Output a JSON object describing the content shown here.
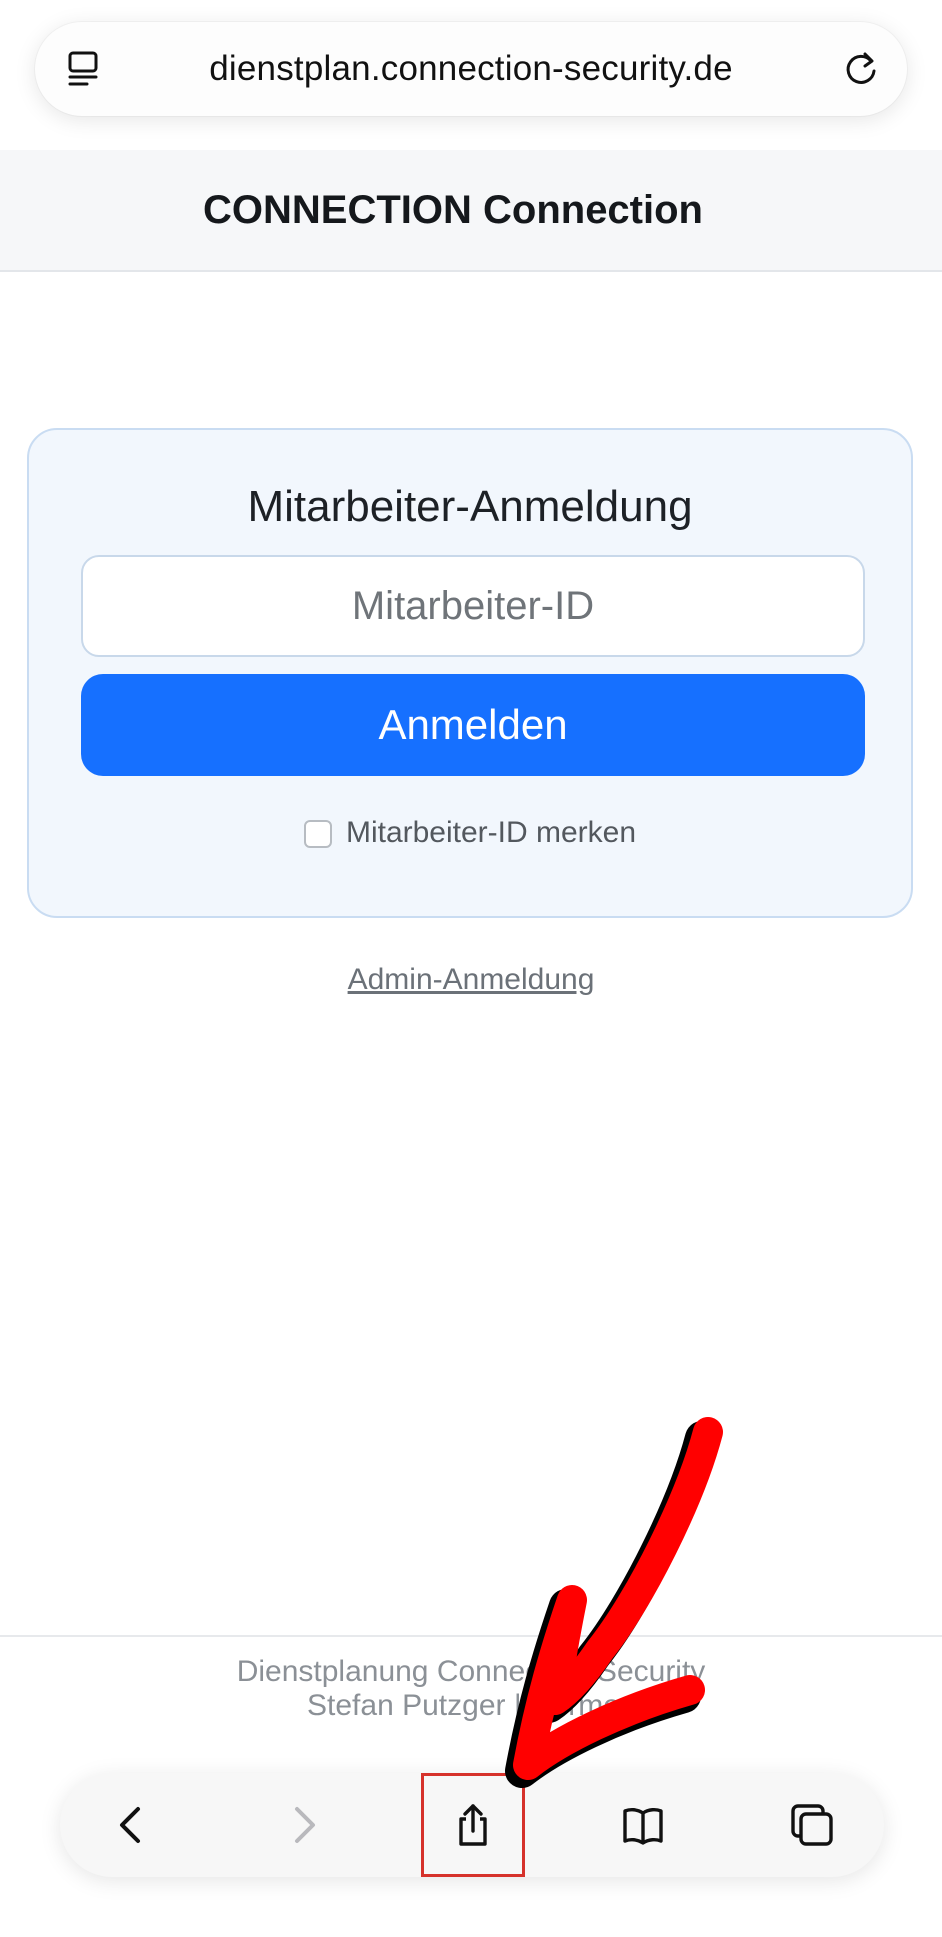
{
  "browser": {
    "url": "dienstplan.connection-security.de",
    "page_menu_icon": "page-menu-icon",
    "reload_icon": "reload-icon"
  },
  "header": {
    "title": "CONNECTION Connection"
  },
  "login": {
    "title": "Mitarbeiter-Anmeldung",
    "id_placeholder": "Mitarbeiter-ID",
    "id_value": "",
    "submit_label": "Anmelden",
    "remember_label": "Mitarbeiter-ID merken",
    "remember_checked": false
  },
  "admin_link": "Admin-Anmeldung",
  "footer": {
    "line1": "Dienstplanung Connection Security",
    "line2": "Stefan Putzger | Hermes"
  },
  "toolbar": {
    "back_icon": "chevron-left-icon",
    "forward_icon": "chevron-right-icon",
    "share_icon": "share-icon",
    "bookmarks_icon": "book-icon",
    "tabs_icon": "tabs-icon"
  },
  "colors": {
    "accent": "#1670ff",
    "annotation_arrow": "#ff0000",
    "highlight_box": "#d6322b"
  }
}
